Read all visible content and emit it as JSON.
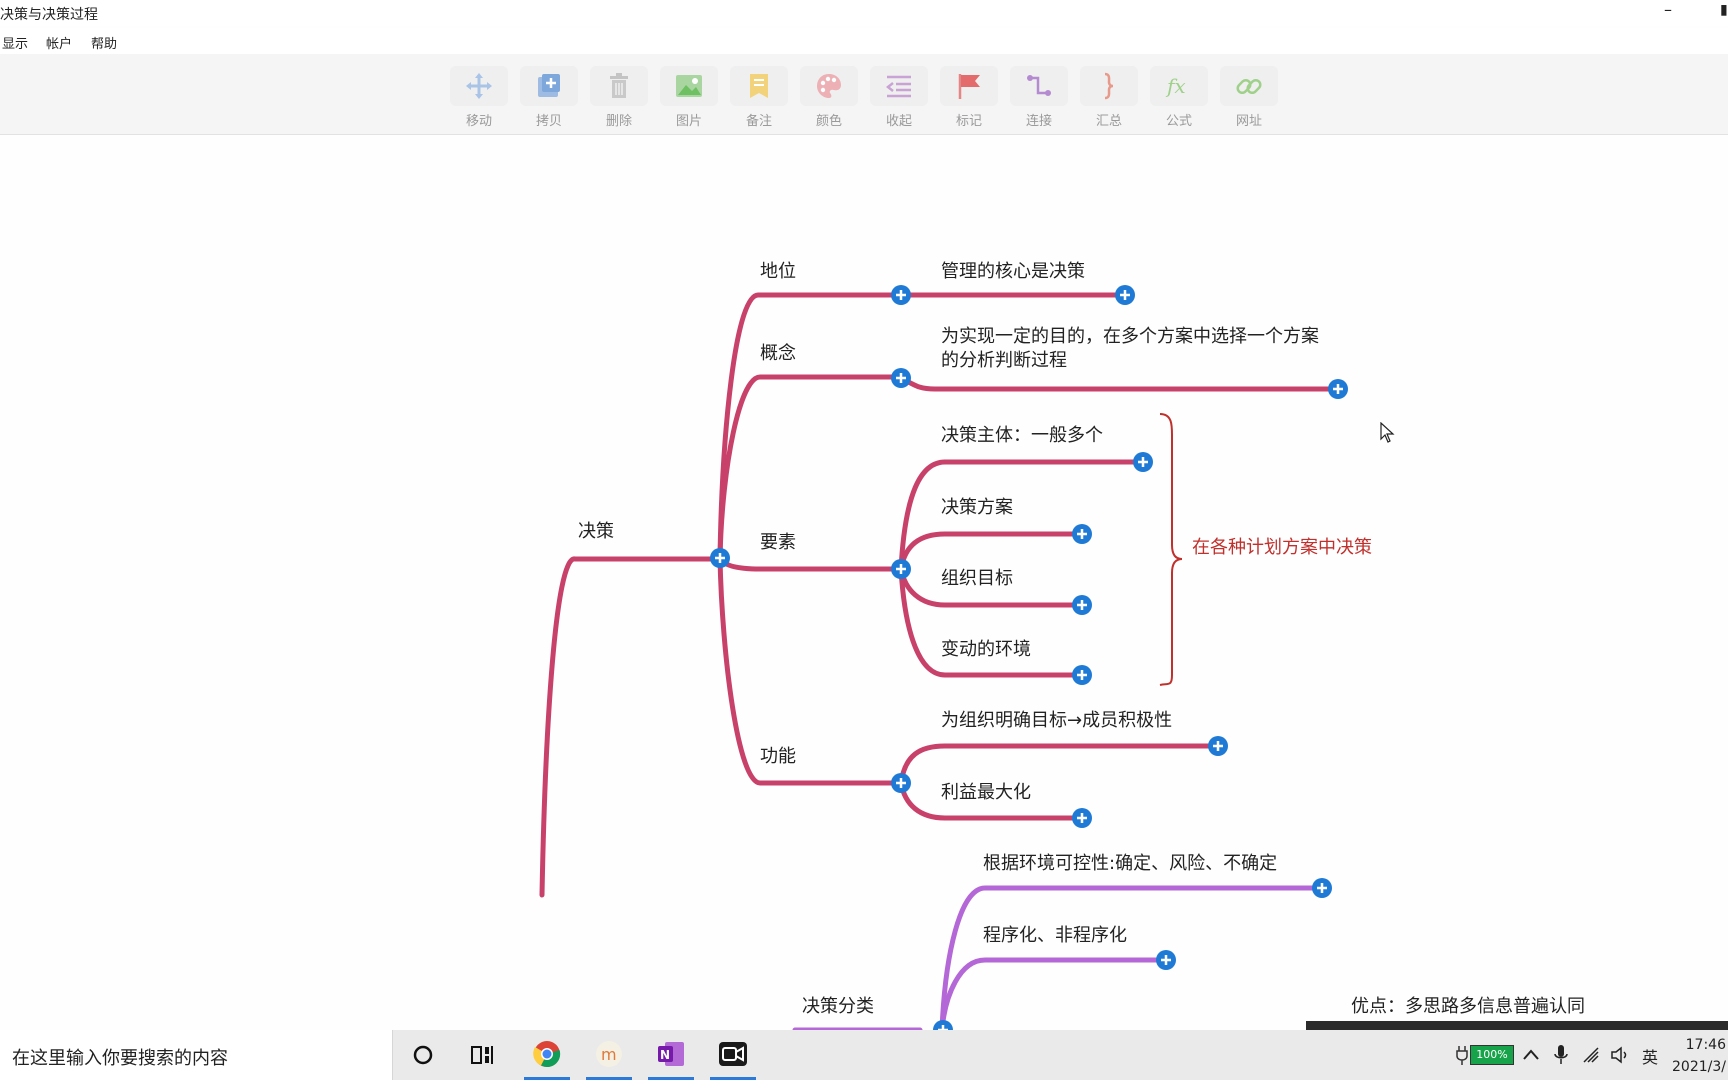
{
  "window": {
    "title": "决策与决策过程",
    "minimize": "–",
    "edge": "▮"
  },
  "menu": [
    "显示",
    "帐户",
    "帮助"
  ],
  "toolbar": [
    {
      "label": "移动",
      "icon": "move-icon"
    },
    {
      "label": "拷贝",
      "icon": "copy-icon"
    },
    {
      "label": "删除",
      "icon": "trash-icon"
    },
    {
      "label": "图片",
      "icon": "image-icon"
    },
    {
      "label": "备注",
      "icon": "note-icon"
    },
    {
      "label": "颜色",
      "icon": "palette-icon"
    },
    {
      "label": "收起",
      "icon": "collapse-icon"
    },
    {
      "label": "标记",
      "icon": "flag-icon"
    },
    {
      "label": "连接",
      "icon": "connect-icon"
    },
    {
      "label": "汇总",
      "icon": "brace-icon"
    },
    {
      "label": "公式",
      "icon": "formula-icon"
    },
    {
      "label": "网址",
      "icon": "link-icon"
    }
  ],
  "mindmap": {
    "root": "决策",
    "branches": {
      "position": "地位",
      "position_child": "管理的核心是决策",
      "concept": "概念",
      "concept_child": "为实现一定的目的，在多个方案中选择一个方案的分析判断过程",
      "elements": "要素",
      "elements_children": [
        "决策主体：一般多个",
        "决策方案",
        "组织目标",
        "变动的环境"
      ],
      "function": "功能",
      "function_children": [
        "为组织明确目标→成员积极性",
        "利益最大化"
      ],
      "classification": "决策分类",
      "classification_children": [
        "根据环境可控性:确定、风险、不确定",
        "程序化、非程序化"
      ]
    },
    "summary": "在各种计划方案中决策",
    "partial_node": "优点：多思路多信息普遍认同"
  },
  "colors": {
    "primary_branch": "#c8416a",
    "secondary_branch": "#b467d6",
    "add_button": "#1f7ad6",
    "summary_text": "#c0302c"
  },
  "taskbar": {
    "search_placeholder": "在这里输入你要搜索的内容",
    "apps": [
      "cortana-icon",
      "task-view-icon",
      "chrome-icon",
      "m-app-icon",
      "onenote-icon",
      "video-app-icon"
    ],
    "battery": "100%",
    "language": "英",
    "time": "17:46",
    "date": "2021/3/"
  }
}
